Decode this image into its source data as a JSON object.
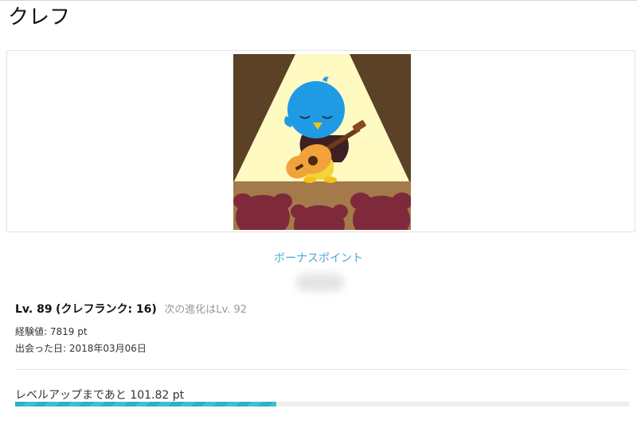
{
  "page": {
    "title": "クレフ"
  },
  "character": {
    "illustration_name": "bird-playing-guitar-on-stage",
    "colors": {
      "background": "#5b4126",
      "spotlight": "#fff9c2",
      "stage": "#a47a4a",
      "audience": "#7f2a3a",
      "bird": "#1f9be3",
      "guitar": "#f2a23a"
    }
  },
  "bonus": {
    "link_label": "ボーナスポイント"
  },
  "stats": {
    "level_label": "Lv. 89",
    "rank_label": "(クレフランク: 16)",
    "next_evolution": "次の進化はLv. 92",
    "exp_label": "経験値: 7819 pt",
    "met_date_label": "出会った日: 2018年03月06日"
  },
  "progress": {
    "label": "レベルアップまであと 101.82 pt",
    "fraction": 0.425,
    "color": "#2cb1c9"
  }
}
